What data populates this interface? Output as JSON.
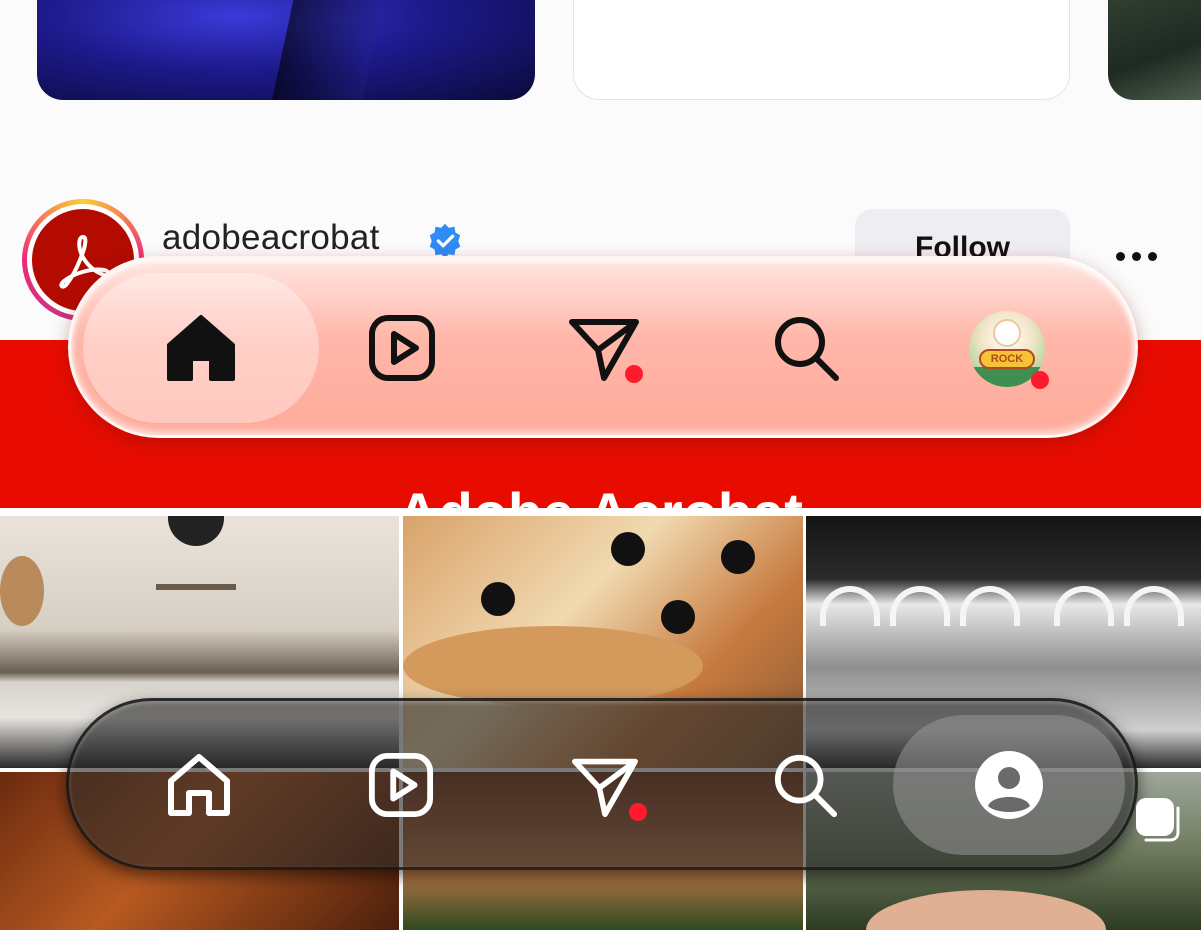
{
  "profile": {
    "username": "adobeacrobat",
    "follow_label": "Follow",
    "banner_title": "Adobe Acrobat"
  },
  "nav_top": {
    "theme": "light",
    "active": "home",
    "items": [
      "home-icon",
      "reels-icon",
      "direct-message-icon",
      "search-icon",
      "profile-avatar"
    ],
    "accent": "#ff1a2e",
    "avatar_badge": "ROCK"
  },
  "nav_bottom": {
    "theme": "dark",
    "active": "profile",
    "items": [
      "home-icon",
      "reels-icon",
      "direct-message-icon",
      "search-icon",
      "profile-icon"
    ]
  },
  "colors": {
    "banner": "#e80c00",
    "verified": "#2f8cf7",
    "notification_dot": "#ff1a2e"
  }
}
